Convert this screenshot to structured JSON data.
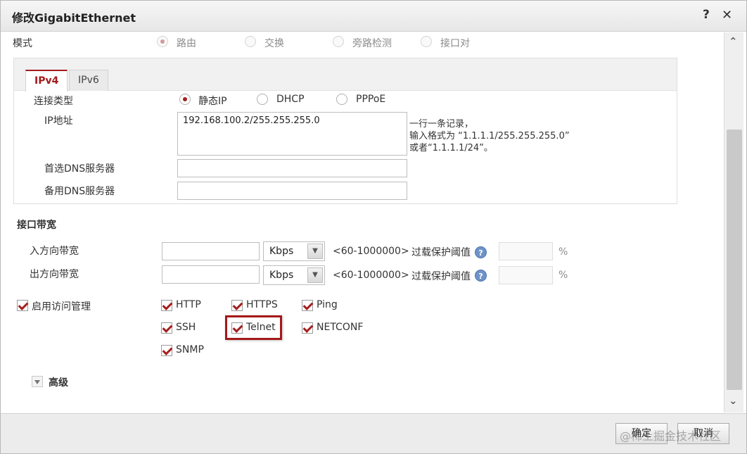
{
  "dialog": {
    "title": "修改GigabitEthernet",
    "help_label": "?",
    "close_label": "✕"
  },
  "mode": {
    "label": "模式",
    "options": [
      {
        "label": "路由",
        "selected": true
      },
      {
        "label": "交换",
        "selected": false
      },
      {
        "label": "旁路检测",
        "selected": false
      },
      {
        "label": "接口对",
        "selected": false
      }
    ]
  },
  "ip_tabs": [
    {
      "label": "IPv4",
      "active": true
    },
    {
      "label": "IPv6",
      "active": false
    }
  ],
  "ipv4": {
    "connection_type_label": "连接类型",
    "connection_types": [
      {
        "label": "静态IP",
        "selected": true
      },
      {
        "label": "DHCP",
        "selected": false
      },
      {
        "label": "PPPoE",
        "selected": false
      }
    ],
    "ip_label": "IP地址",
    "ip_value": "192.168.100.2/255.255.255.0",
    "ip_hint_1": "一行一条记录，",
    "ip_hint_2": "输入格式为 “1.1.1.1/255.255.255.0”",
    "ip_hint_3": "或者“1.1.1.1/24”。",
    "dns1_label": "首选DNS服务器",
    "dns1_value": "",
    "dns2_label": "备用DNS服务器",
    "dns2_value": ""
  },
  "bandwidth": {
    "section_label": "接口带宽",
    "inbound_label": "入方向带宽",
    "outbound_label": "出方向带宽",
    "inbound_value": "",
    "outbound_value": "",
    "unit": "Kbps",
    "range": "<60-1000000>",
    "threshold_label": "过载保护阈值",
    "help_glyph": "?",
    "percent": "%"
  },
  "access": {
    "enable_label": "启用访问管理",
    "enabled": true,
    "services": [
      {
        "label": "HTTP",
        "checked": true
      },
      {
        "label": "HTTPS",
        "checked": true
      },
      {
        "label": "Ping",
        "checked": true
      },
      {
        "label": "SSH",
        "checked": true
      },
      {
        "label": "Telnet",
        "checked": true
      },
      {
        "label": "NETCONF",
        "checked": true
      },
      {
        "label": "SNMP",
        "checked": true
      }
    ]
  },
  "advanced": {
    "label": "高级"
  },
  "footer": {
    "ok_label": "确定",
    "cancel_label": "取消",
    "watermark": "@稀土掘金技术社区"
  },
  "colors": {
    "accent": "#a51f1f",
    "highlight_border": "#a51818"
  }
}
